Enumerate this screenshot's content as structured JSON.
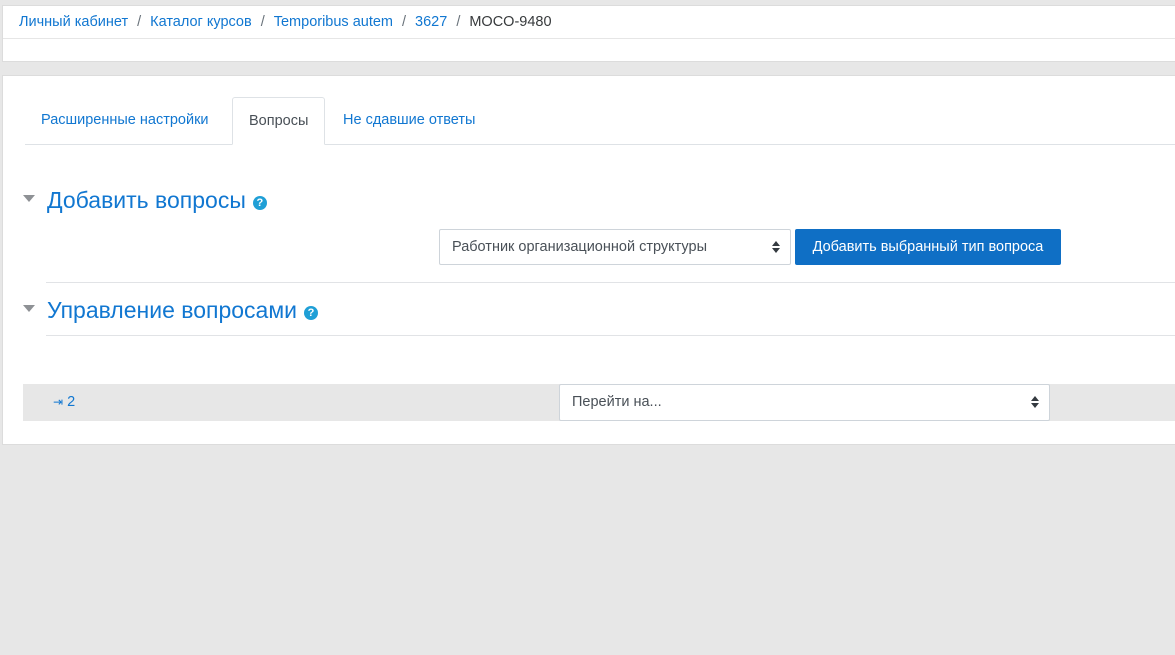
{
  "breadcrumb": {
    "items": [
      "Личный кабинет",
      "Каталог курсов",
      "Temporibus autem",
      "3627"
    ],
    "separator": "/",
    "current": "MOCO-9480"
  },
  "tabs": [
    {
      "label": "Расширенные настройки",
      "active": false
    },
    {
      "label": "Вопросы",
      "active": true
    },
    {
      "label": "Не сдавшие ответы",
      "active": false
    }
  ],
  "add_questions": {
    "title": "Добавить вопросы",
    "help_icon": "?",
    "question_type_selected": "Работник организационной структуры",
    "add_button_label": "Добавить выбранный тип вопроса"
  },
  "manage_questions": {
    "title": "Управление вопросами",
    "help_icon": "?"
  },
  "navigation": {
    "page_link_icon": "⇥",
    "page_link_label": "2",
    "jump_placeholder": "Перейти на..."
  },
  "colors": {
    "accent": "#1177d1",
    "button_bg": "#0f6fc5",
    "help_icon": "#1f9fd6",
    "page_bg": "#e7e7e7"
  }
}
